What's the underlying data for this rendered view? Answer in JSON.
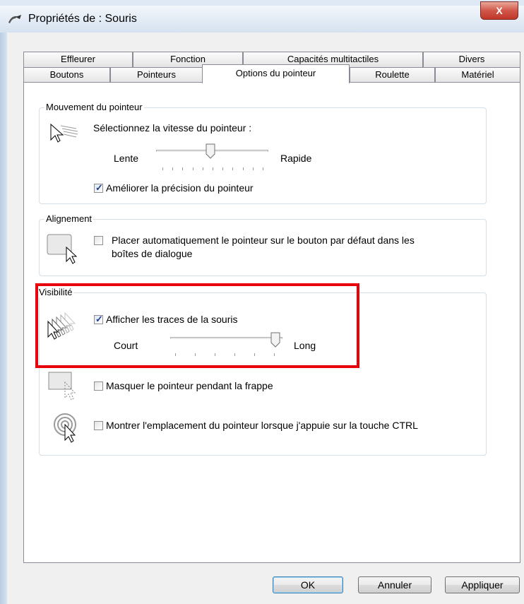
{
  "window": {
    "title": "Propriétés de : Souris",
    "close_label": "X"
  },
  "tabs_row_back": [
    {
      "label": "Effleurer"
    },
    {
      "label": "Fonction"
    },
    {
      "label": "Capacités multitactiles"
    },
    {
      "label": "Divers"
    }
  ],
  "tabs_row_front": [
    {
      "label": "Boutons"
    },
    {
      "label": "Pointeurs"
    },
    {
      "label": "Options du pointeur",
      "selected": true
    },
    {
      "label": "Roulette"
    },
    {
      "label": "Matériel"
    }
  ],
  "motion": {
    "group_title": "Mouvement du pointeur",
    "speed_prompt": "Sélectionnez la vitesse du pointeur :",
    "slow_label": "Lente",
    "fast_label": "Rapide",
    "speed_level": 0.6,
    "precision_label": "Améliorer la précision du pointeur",
    "precision_checked": true
  },
  "snap": {
    "group_title": "Alignement",
    "label_line1": "Placer automatiquement le pointeur sur le bouton par défaut dans les",
    "label_line2": "boîtes de dialogue",
    "checked": false
  },
  "visibility": {
    "group_title": "Visibilité",
    "trails_label": "Afficher les traces de la souris",
    "trails_checked": true,
    "short_label": "Court",
    "long_label": "Long",
    "trail_level": 1.0,
    "hide_label": "Masquer le pointeur pendant la frappe",
    "hide_checked": false,
    "ctrl_label": "Montrer l'emplacement du pointeur lorsque j'appuie sur la touche CTRL",
    "ctrl_checked": false
  },
  "buttons": {
    "ok": "OK",
    "cancel": "Annuler",
    "apply": "Appliquer"
  },
  "colors": {
    "highlight": "#e8000b",
    "checkmark": "#1b3f8c",
    "close_button": "#c2362a"
  }
}
